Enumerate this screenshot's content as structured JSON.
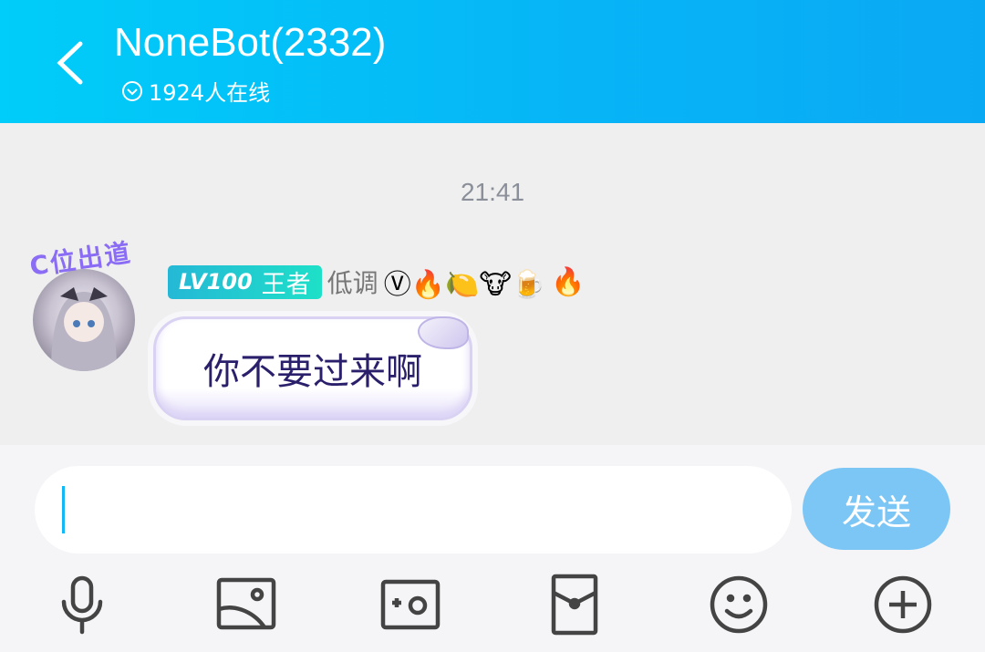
{
  "header": {
    "title": "NoneBot(2332)",
    "online": "1924人在线"
  },
  "chat": {
    "timestamp": "21:41",
    "messages": [
      {
        "avatar_caption": "C位出道",
        "level_badge": "LV100",
        "rank": "王者",
        "nickname": "低调",
        "emojis": "Ⓥ🔥🍋🐮🍺",
        "fire_emoji": "🔥",
        "text": "你不要过来啊"
      }
    ]
  },
  "input": {
    "value": "",
    "send_label": "发送"
  },
  "toolbar": [
    "microphone",
    "image",
    "camera",
    "red-packet",
    "emoji",
    "plus"
  ],
  "colors": {
    "header": "#07b4f6",
    "send": "#7cc6f6",
    "caret": "#12b7f5"
  }
}
